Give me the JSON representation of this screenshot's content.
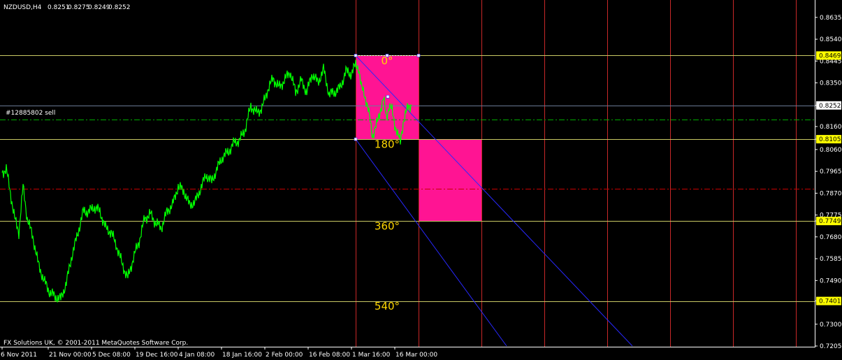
{
  "chart_data": {
    "type": "line",
    "header": {
      "symbol": "NZDUSD,H4",
      "ohlc": [
        "0.8251",
        "0.8275",
        "0.8249",
        "0.8252"
      ]
    },
    "copyright": "FX Solutions UK, © 2001-2011 MetaQuotes Software Corp.",
    "order_label": "#12885802 sell",
    "ylim": [
      0.7205,
      0.8665
    ],
    "y_ticks": [
      0.8635,
      0.854,
      0.8445,
      0.835,
      0.8252,
      0.816,
      0.8105,
      0.806,
      0.7965,
      0.787,
      0.7775,
      0.7749,
      0.768,
      0.7585,
      0.749,
      0.7401,
      0.73,
      0.7205
    ],
    "x_ticks": [
      {
        "label": "6 Nov 2011",
        "bar": 0
      },
      {
        "label": "21 Nov 00:00",
        "bar": 66
      },
      {
        "label": "5 Dec 08:00",
        "bar": 128
      },
      {
        "label": "19 Dec 16:00",
        "bar": 190
      },
      {
        "label": "4 Jan 08:00",
        "bar": 252
      },
      {
        "label": "18 Jan 16:00",
        "bar": 314
      },
      {
        "label": "2 Feb 00:00",
        "bar": 376
      },
      {
        "label": "16 Feb 08:00",
        "bar": 438
      },
      {
        "label": "1 Mar 16:00",
        "bar": 500
      },
      {
        "label": "16 Mar 00:00",
        "bar": 562
      }
    ],
    "series": [
      {
        "color": "#00ff00",
        "points": [
          [
            0,
            0.796
          ],
          [
            6,
            0.7975
          ],
          [
            12,
            0.787
          ],
          [
            18,
            0.776
          ],
          [
            24,
            0.77
          ],
          [
            30,
            0.79
          ],
          [
            36,
            0.776
          ],
          [
            44,
            0.768
          ],
          [
            52,
            0.756
          ],
          [
            60,
            0.749
          ],
          [
            68,
            0.744
          ],
          [
            76,
            0.742
          ],
          [
            84,
            0.741
          ],
          [
            92,
            0.748
          ],
          [
            100,
            0.76
          ],
          [
            108,
            0.769
          ],
          [
            116,
            0.779
          ],
          [
            124,
            0.779
          ],
          [
            132,
            0.781
          ],
          [
            140,
            0.779
          ],
          [
            148,
            0.772
          ],
          [
            156,
            0.77
          ],
          [
            164,
            0.764
          ],
          [
            172,
            0.756
          ],
          [
            180,
            0.75
          ],
          [
            188,
            0.759
          ],
          [
            196,
            0.766
          ],
          [
            204,
            0.776
          ],
          [
            212,
            0.778
          ],
          [
            220,
            0.774
          ],
          [
            228,
            0.772
          ],
          [
            236,
            0.779
          ],
          [
            244,
            0.782
          ],
          [
            252,
            0.79
          ],
          [
            260,
            0.788
          ],
          [
            268,
            0.782
          ],
          [
            276,
            0.783
          ],
          [
            284,
            0.789
          ],
          [
            292,
            0.795
          ],
          [
            300,
            0.792
          ],
          [
            308,
            0.798
          ],
          [
            316,
            0.803
          ],
          [
            324,
            0.805
          ],
          [
            332,
            0.809
          ],
          [
            340,
            0.81
          ],
          [
            348,
            0.815
          ],
          [
            356,
            0.825
          ],
          [
            364,
            0.822
          ],
          [
            372,
            0.824
          ],
          [
            380,
            0.832
          ],
          [
            388,
            0.837
          ],
          [
            396,
            0.833
          ],
          [
            404,
            0.836
          ],
          [
            412,
            0.84
          ],
          [
            420,
            0.831
          ],
          [
            428,
            0.836
          ],
          [
            436,
            0.831
          ],
          [
            444,
            0.839
          ],
          [
            452,
            0.835
          ],
          [
            460,
            0.841
          ],
          [
            468,
            0.83
          ],
          [
            476,
            0.831
          ],
          [
            484,
            0.833
          ],
          [
            492,
            0.84
          ],
          [
            500,
            0.839
          ],
          [
            506,
            0.843
          ],
          [
            510,
            0.842
          ],
          [
            514,
            0.833
          ],
          [
            518,
            0.831
          ],
          [
            522,
            0.826
          ],
          [
            526,
            0.82
          ],
          [
            530,
            0.812
          ],
          [
            534,
            0.815
          ],
          [
            538,
            0.819
          ],
          [
            542,
            0.824
          ],
          [
            546,
            0.828
          ],
          [
            550,
            0.82
          ],
          [
            554,
            0.825
          ],
          [
            558,
            0.823
          ],
          [
            562,
            0.817
          ],
          [
            566,
            0.813
          ],
          [
            570,
            0.809
          ],
          [
            574,
            0.818
          ],
          [
            578,
            0.822
          ],
          [
            582,
            0.825
          ],
          [
            586,
            0.8252
          ]
        ]
      }
    ],
    "price_labels": [
      {
        "value": 0.8469,
        "text": "0.8469",
        "line_color": "#c8c864"
      },
      {
        "value": 0.8252,
        "text": "0.8252",
        "line_color": "#6a7a95"
      },
      {
        "value": 0.8105,
        "text": "0.8105",
        "line_color": "#c8c864"
      },
      {
        "value": 0.7749,
        "text": "0.7749",
        "line_color": "#c8c864"
      },
      {
        "value": 0.7401,
        "text": "0.7401",
        "line_color": "#c8c864"
      }
    ],
    "order_line": {
      "value": 0.819,
      "color": "#00aa00"
    },
    "dashed_line": {
      "value": 0.789,
      "color": "#c80000"
    },
    "vertical_lines_bar": [
      506,
      596,
      686,
      776,
      866,
      956,
      1046,
      1136
    ],
    "gann_boxes": [
      {
        "bar_from": 506,
        "bar_to": 596,
        "top": 0.8469,
        "bottom": 0.8105,
        "color": "#ff1493"
      },
      {
        "bar_from": 596,
        "bar_to": 686,
        "top": 0.8105,
        "bottom": 0.7749,
        "color": "#ff1493"
      }
    ],
    "degree_labels": [
      {
        "text": "0°",
        "value": 0.8446,
        "color": "#ffd700"
      },
      {
        "text": "180°",
        "value": 0.8083,
        "color": "#ffd700"
      },
      {
        "text": "360°",
        "value": 0.7727,
        "color": "#ffd700"
      },
      {
        "text": "540°",
        "value": 0.7379,
        "color": "#ffd700"
      }
    ],
    "blue_lines": [
      {
        "from": [
          506,
          0.8469
        ],
        "to": [
          902,
          0.7205
        ]
      },
      {
        "from": [
          506,
          0.8105
        ],
        "to": [
          722,
          0.7205
        ]
      }
    ]
  }
}
